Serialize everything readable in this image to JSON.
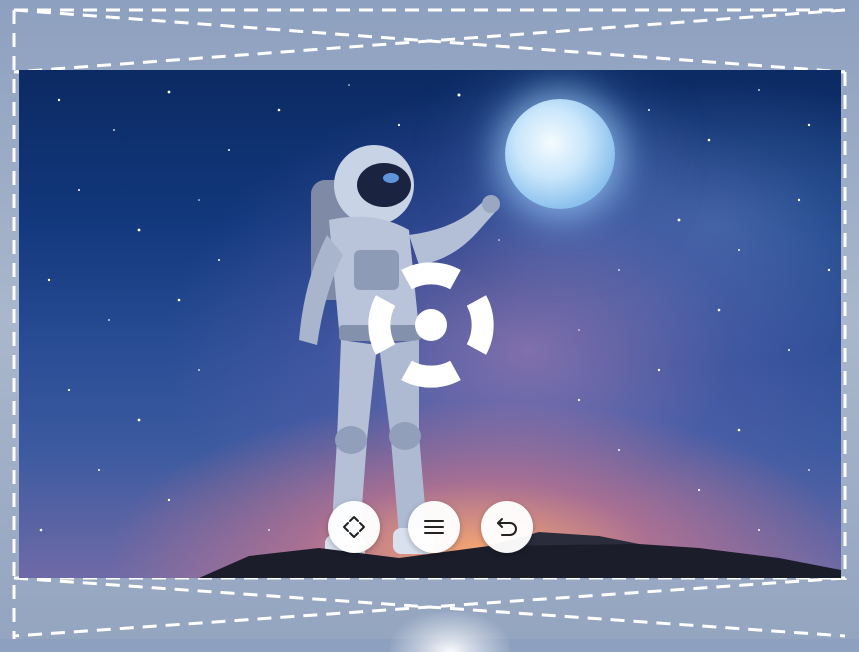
{
  "screen": {
    "scene": "astronaut-under-moon",
    "colors": {
      "sky_top": "#0c2a63",
      "sky_bottom": "#6f6aa7",
      "glow": "#ffaa6e",
      "moon": "#c9e6fb"
    }
  },
  "dpad": {
    "up_icon": "▲",
    "down_icon": "▼",
    "left_icon": "◀",
    "right_icon": "▶"
  },
  "controls": {
    "fit_icon": "expand-arrows-icon",
    "menu_icon": "menu-icon",
    "back_icon": "undo-arrow-icon"
  },
  "frame": {
    "background": "#9aaac4",
    "guide_line_color": "#ffffff"
  }
}
